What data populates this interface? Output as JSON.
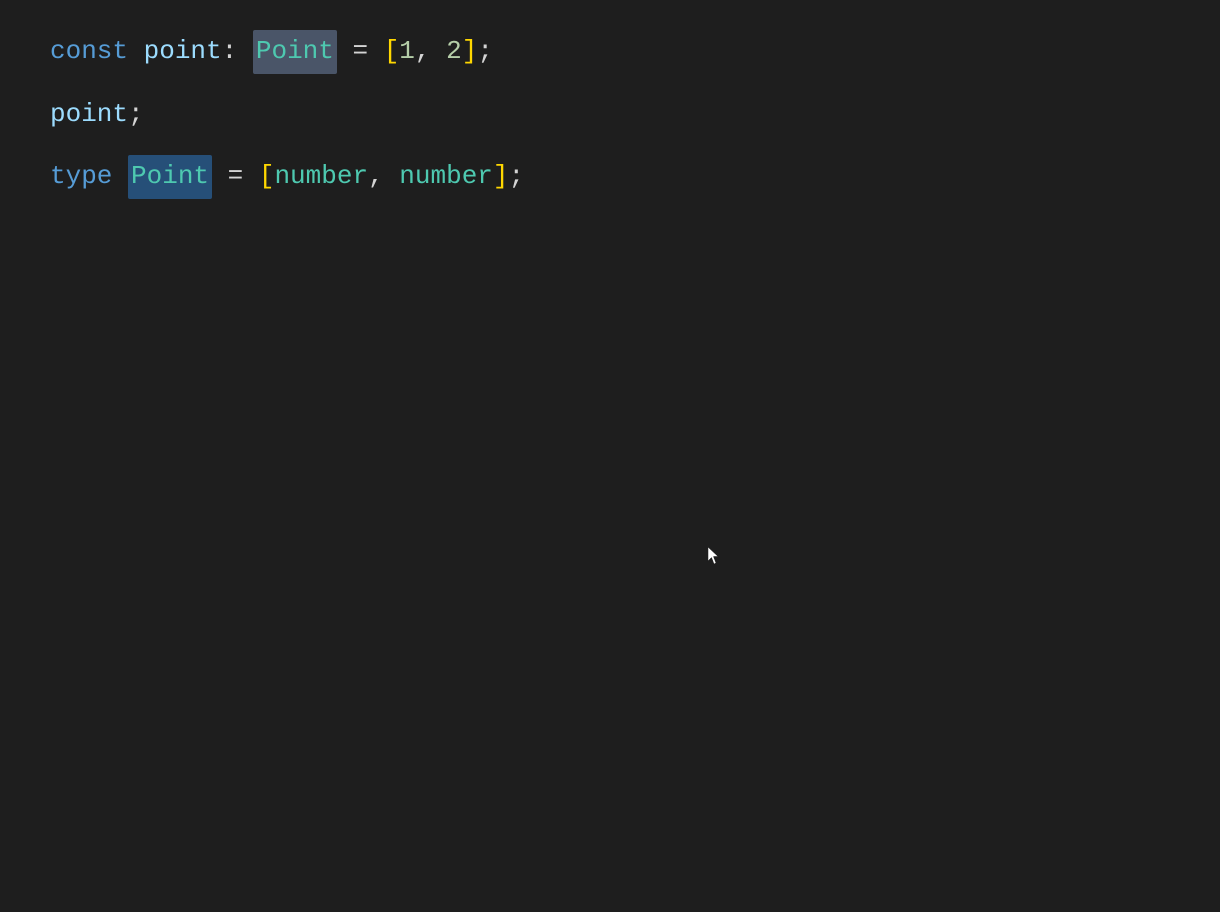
{
  "editor": {
    "background": "#1e1e1e",
    "lines": [
      {
        "id": "line1",
        "tokens": [
          {
            "type": "keyword-const",
            "text": "const "
          },
          {
            "type": "variable",
            "text": "point"
          },
          {
            "type": "colon",
            "text": ": "
          },
          {
            "type": "type-name-highlight",
            "text": "Point"
          },
          {
            "type": "operator",
            "text": " = "
          },
          {
            "type": "bracket",
            "text": "["
          },
          {
            "type": "number",
            "text": "1"
          },
          {
            "type": "comma",
            "text": ", "
          },
          {
            "type": "number",
            "text": "2"
          },
          {
            "type": "bracket",
            "text": "]"
          },
          {
            "type": "semicolon",
            "text": ";"
          }
        ]
      },
      {
        "id": "line2",
        "tokens": [
          {
            "type": "variable",
            "text": "point"
          },
          {
            "type": "semicolon",
            "text": ";"
          }
        ]
      },
      {
        "id": "line3",
        "tokens": [
          {
            "type": "keyword-type",
            "text": "type "
          },
          {
            "type": "point-highlight",
            "text": "Point"
          },
          {
            "type": "operator",
            "text": " = "
          },
          {
            "type": "bracket",
            "text": "["
          },
          {
            "type": "builtin",
            "text": "number"
          },
          {
            "type": "comma",
            "text": ", "
          },
          {
            "type": "builtin",
            "text": "number"
          },
          {
            "type": "bracket",
            "text": "]"
          },
          {
            "type": "semicolon",
            "text": ";"
          }
        ]
      }
    ]
  }
}
